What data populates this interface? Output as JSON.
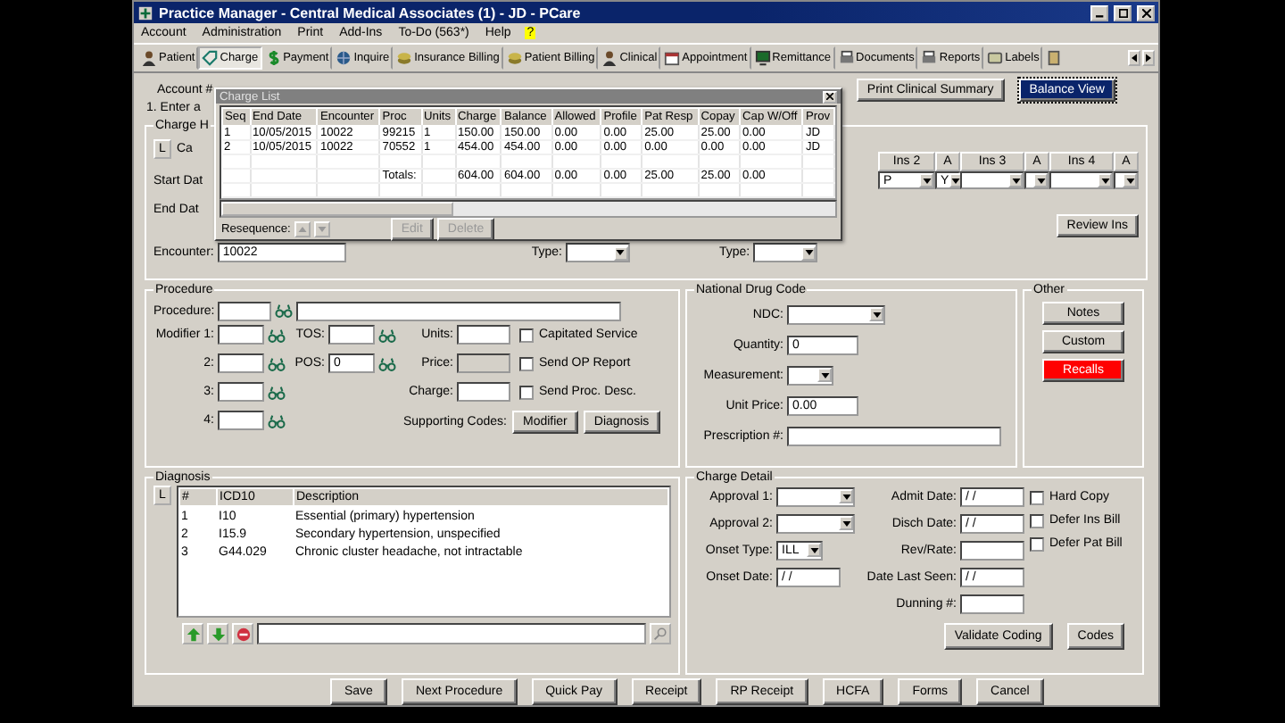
{
  "window": {
    "title": "Practice Manager - Central Medical Associates (1) - JD - PCare"
  },
  "menu": [
    {
      "label": "Account",
      "highlighted": false
    },
    {
      "label": "Administration",
      "highlighted": false
    },
    {
      "label": "Print",
      "highlighted": false
    },
    {
      "label": "Add-Ins",
      "highlighted": false
    },
    {
      "label": "To-Do (563*)",
      "highlighted": false
    },
    {
      "label": "Help",
      "highlighted": false
    },
    {
      "label": "?",
      "highlighted": true
    }
  ],
  "toolbar": [
    {
      "label": "Patient",
      "selected": false
    },
    {
      "label": "Charge",
      "selected": true
    },
    {
      "label": "Payment",
      "selected": false
    },
    {
      "label": "Inquire",
      "selected": false
    },
    {
      "label": "Insurance Billing",
      "selected": false
    },
    {
      "label": "Patient Billing",
      "selected": false
    },
    {
      "label": "Clinical",
      "selected": false
    },
    {
      "label": "Appointment",
      "selected": false
    },
    {
      "label": "Remittance",
      "selected": false
    },
    {
      "label": "Documents",
      "selected": false
    },
    {
      "label": "Reports",
      "selected": false
    },
    {
      "label": "Labels",
      "selected": false
    }
  ],
  "account": {
    "label": "Account #"
  },
  "header_buttons": [
    {
      "label": "Print Clinical Summary",
      "focused": false
    },
    {
      "label": "Balance View",
      "focused": true
    }
  ],
  "entry": {
    "step_label": "1. Enter a",
    "group_label": "Charge H",
    "list_button": "L",
    "list_label": "Ca",
    "start_label": "Start Dat",
    "end_label": "End Dat",
    "encounter": {
      "label": "Encounter:",
      "value": "10022"
    },
    "type_fields": [
      {
        "label": "Type:"
      },
      {
        "label": "Type:"
      }
    ],
    "insurance": [
      {
        "header": "Ins 2",
        "value": "P"
      },
      {
        "header": "A",
        "value": "Y"
      },
      {
        "header": "Ins 3"
      },
      {
        "header": "A"
      },
      {
        "header": "Ins 4"
      },
      {
        "header": "A"
      }
    ],
    "review_button": "Review Ins"
  },
  "charge_list": {
    "title": "Charge List",
    "columns": [
      "Seq",
      "End Date",
      "Encounter",
      "Proc",
      "Units",
      "Charge",
      "Balance",
      "Allowed",
      "Profile",
      "Pat Resp",
      "Copay",
      "Cap W/Off",
      "Prov"
    ],
    "rows": [
      [
        "1",
        "10/05/2015",
        "10022",
        "99215",
        "1",
        "150.00",
        "150.00",
        "0.00",
        "0.00",
        "25.00",
        "25.00",
        "0.00",
        "JD"
      ],
      [
        "2",
        "10/05/2015",
        "10022",
        "70552",
        "1",
        "454.00",
        "454.00",
        "0.00",
        "0.00",
        "0.00",
        "0.00",
        "0.00",
        "JD"
      ]
    ],
    "totals": {
      "label": "Totals:",
      "values": [
        "604.00",
        "604.00",
        "0.00",
        "0.00",
        "25.00",
        "25.00",
        "0.00"
      ]
    },
    "resequence_label": "Resequence:",
    "buttons": [
      {
        "label": "Edit",
        "disabled": true
      },
      {
        "label": "Delete",
        "disabled": true
      }
    ]
  },
  "procedure": {
    "title": "Procedure",
    "procedure_label": "Procedure:",
    "modifiers": [
      {
        "label": "Modifier 1:"
      },
      {
        "label": "2:"
      },
      {
        "label": "3:"
      },
      {
        "label": "4:"
      }
    ],
    "codes": [
      {
        "label": "TOS:"
      },
      {
        "label": "POS:",
        "value": "0"
      }
    ],
    "amounts": [
      {
        "label": "Units:",
        "disabled": false
      },
      {
        "label": "Price:",
        "disabled": true
      },
      {
        "label": "Charge:",
        "disabled": false
      }
    ],
    "options": [
      {
        "label": "Capitated Service",
        "checked": false
      },
      {
        "label": "Send OP Report",
        "checked": false
      },
      {
        "label": "Send Proc. Desc.",
        "checked": false
      }
    ],
    "supporting_label": "Supporting Codes:",
    "supporting_buttons": [
      "Modifier",
      "Diagnosis"
    ]
  },
  "ndc": {
    "title": "National Drug Code",
    "fields": [
      {
        "label": "NDC:",
        "kind": "dropdown"
      },
      {
        "label": "Quantity:",
        "kind": "text",
        "value": "0"
      },
      {
        "label": "Measurement:",
        "kind": "short-dropdown"
      },
      {
        "label": "Unit Price:",
        "kind": "text",
        "value": "0.00"
      },
      {
        "label": "Prescription #:",
        "kind": "wide"
      }
    ]
  },
  "other": {
    "title": "Other",
    "buttons": [
      {
        "label": "Notes",
        "alert": false
      },
      {
        "label": "Custom",
        "alert": false
      },
      {
        "label": "Recalls",
        "alert": true
      }
    ]
  },
  "diagnosis": {
    "title": "Diagnosis",
    "list_button": "L",
    "columns": [
      "#",
      "ICD10",
      "Description"
    ],
    "rows": [
      [
        "1",
        "I10",
        "Essential (primary) hypertension"
      ],
      [
        "2",
        "I15.9",
        "Secondary hypertension, unspecified"
      ],
      [
        "3",
        "G44.029",
        "Chronic cluster headache, not intractable"
      ]
    ]
  },
  "charge_detail": {
    "title": "Charge Detail",
    "left": [
      {
        "label": "Approval 1:",
        "kind": "dropdown"
      },
      {
        "label": "Approval 2:",
        "kind": "dropdown"
      },
      {
        "label": "Onset Type:",
        "kind": "short-dropdown",
        "value": "ILL"
      },
      {
        "label": "Onset Date:",
        "kind": "text",
        "value": "/ /"
      }
    ],
    "middle": [
      {
        "label": "Admit Date:",
        "kind": "text",
        "value": "/ /"
      },
      {
        "label": "Disch Date:",
        "kind": "text",
        "value": "/ /"
      },
      {
        "label": "Rev/Rate:",
        "kind": "text"
      },
      {
        "label": "Date Last Seen:",
        "kind": "text",
        "value": "/ /"
      },
      {
        "label": "Dunning #:",
        "kind": "text"
      }
    ],
    "options": [
      {
        "label": "Hard Copy",
        "checked": false
      },
      {
        "label": "Defer Ins Bill",
        "checked": false
      },
      {
        "label": "Defer Pat Bill",
        "checked": false
      }
    ],
    "buttons": [
      "Validate Coding",
      "Codes"
    ]
  },
  "actions": [
    "Save",
    "Next Procedure",
    "Quick Pay",
    "Receipt",
    "RP Receipt",
    "HCFA",
    "Forms",
    "Cancel"
  ]
}
